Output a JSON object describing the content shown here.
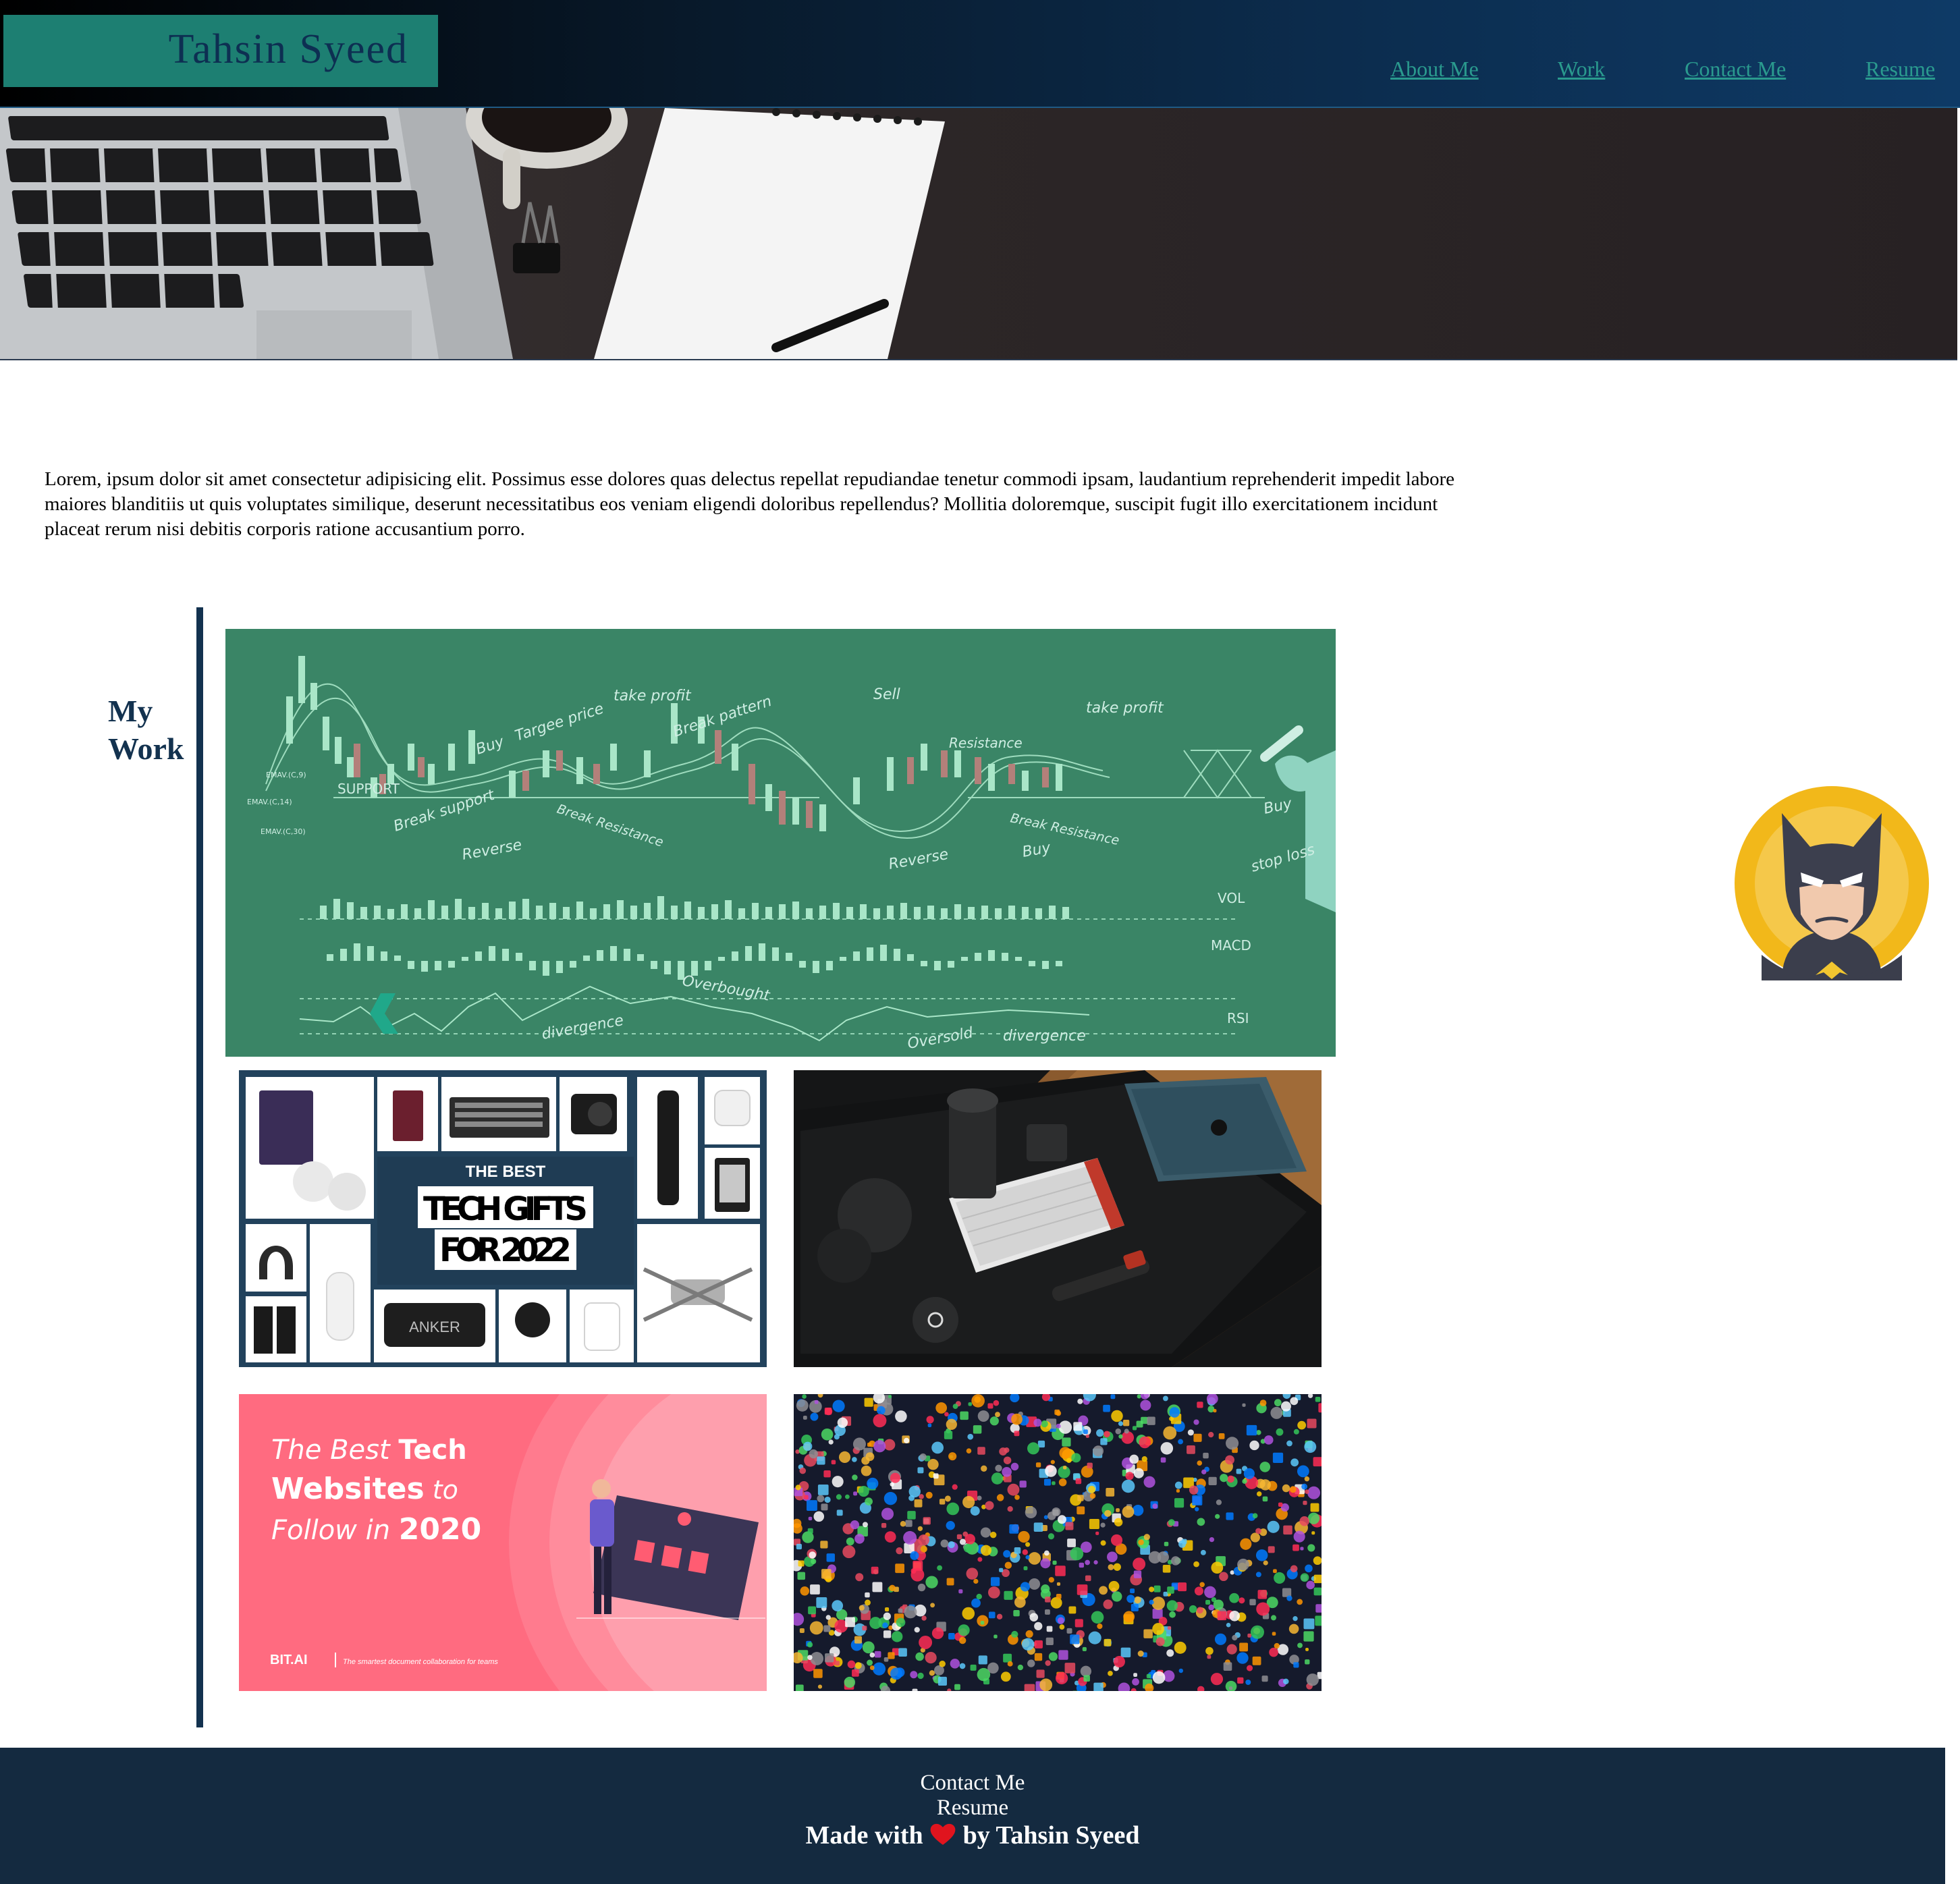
{
  "header": {
    "brand": "Tahsin Syeed",
    "nav": [
      "About Me",
      "Work",
      "Contact Me",
      "Resume"
    ]
  },
  "about": {
    "text": "Lorem, ipsum dolor sit amet consectetur adipisicing elit. Possimus esse dolores quas delectus repellat repudiandae tenetur commodi ipsam, laudantium reprehenderit impedit labore maiores blanditiis ut quis voluptates similique, deserunt necessitatibus eos veniam eligendi doloribus repellendus? Mollitia doloremque, suscipit fugit illo exercitationem incidunt placeat rerum nisi debitis corporis ratione accusantium porro."
  },
  "work": {
    "title_line1": "My",
    "title_line2": "Work",
    "trading": {
      "labels": [
        "take profit",
        "Sell",
        "take profit",
        "Targee price",
        "Break pattern",
        "Resistance",
        "SUPPORT",
        "Buy",
        "Break support",
        "Break Resistance",
        "Reverse",
        "Reverse",
        "Break Resistance",
        "Buy",
        "Buy",
        "stop loss",
        "VOL",
        "MACD",
        "Overbought",
        "RSI",
        "divergence",
        "Oversold",
        "divergence",
        "EMAV.(C,9)",
        "EMAV.(C,14)",
        "EMAV.(C,30)"
      ]
    },
    "gifts": {
      "line1": "THE BEST",
      "line2": "TECH GIFTS",
      "line3": "FOR 2022",
      "brand": "ANKER"
    },
    "websites": {
      "w1": "The Best ",
      "w2": "Tech",
      "w3": "Websites",
      "w4": " to",
      "w5": "Follow in ",
      "w6": "2020",
      "logo": "BIT.AI",
      "tagline": "The smartest document collaboration for teams"
    }
  },
  "footer": {
    "contact": "Contact Me",
    "resume": "Resume",
    "made_prefix": "Made with",
    "made_suffix": "by Tahsin Syeed"
  },
  "colors": {
    "brand_bg": "#1d7f72",
    "navy": "#13324f",
    "link": "#2a9a8e",
    "footer_bg": "#142a40",
    "chart_green": "#3a8566"
  }
}
